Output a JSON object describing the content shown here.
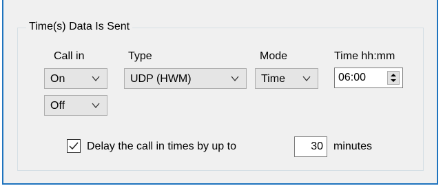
{
  "group": {
    "title": "Time(s) Data Is Sent"
  },
  "columns": {
    "call_in": "Call in",
    "type": "Type",
    "mode": "Mode",
    "time": "Time hh:mm"
  },
  "fields": {
    "call_in_1": "On",
    "call_in_2": "Off",
    "type": "UDP (HWM)",
    "mode": "Time",
    "time": "06:00"
  },
  "delay": {
    "checked": true,
    "label_before": "Delay the call in times by up to",
    "value": "30",
    "label_after": "minutes"
  },
  "icons": {
    "dropdown": "chevron-down-icon",
    "spinner": "spin-up-down-icon",
    "check": "checkmark-icon"
  },
  "colors": {
    "window_border": "#1e73be",
    "panel_bg": "#f0f0f0",
    "combo_bg": "#e5e5e5"
  }
}
